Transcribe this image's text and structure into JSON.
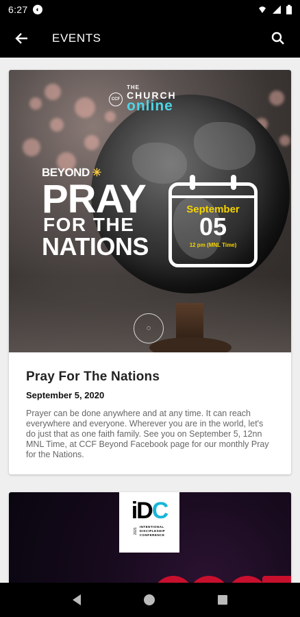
{
  "status_bar": {
    "time": "6:27"
  },
  "app_bar": {
    "title": "EVENTS"
  },
  "events": [
    {
      "poster": {
        "brand_the": "THE",
        "brand_church": "CHURCH",
        "brand_online": "online",
        "beyond": "BEYOND",
        "line1": "PRAY",
        "line2": "FOR THE",
        "line3": "NATIONS",
        "month": "September",
        "day": "05",
        "time": "12 pm (MNL Time)"
      },
      "title": "Pray For The Nations",
      "date": "September 5, 2020",
      "description": "Prayer can be done anywhere and at any time. It can reach everywhere and everyone. Wherever you are in the world, let's do just that as one faith family. See you on September 5, 12nn MNL Time, at CCF Beyond Facebook page for our monthly Pray for the Nations."
    },
    {
      "poster": {
        "mark_i": "i",
        "mark_d": "D",
        "mark_c": "C",
        "year": "2021",
        "line1": "INTENTIONAL",
        "line2": "DISCIPLESHIP",
        "line3": "CONFERENCE"
      }
    }
  ],
  "colors": {
    "accent_cyan": "#4fd4e6",
    "accent_yellow": "#f5d400",
    "idc_blue": "#19b6d9",
    "idc_red": "#c8102e"
  }
}
